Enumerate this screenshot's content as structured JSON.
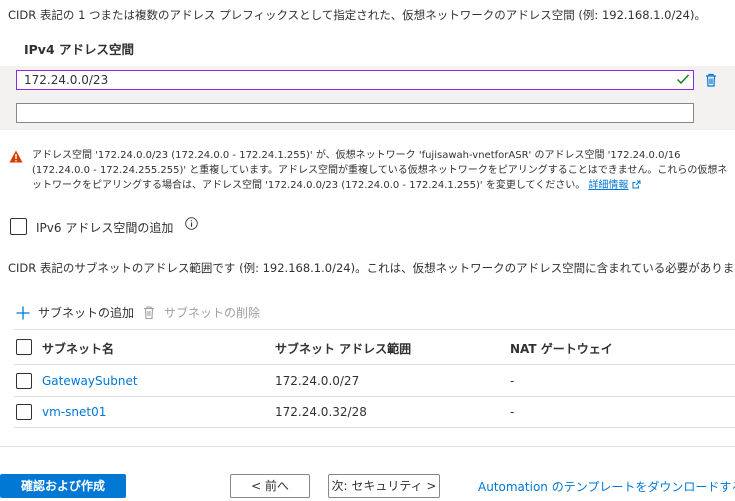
{
  "intro_text": "CIDR 表記の 1 つまたは複数のアドレス プレフィックスとして指定された、仮想ネットワークのアドレス空間 (例: 192.168.1.0/24)。",
  "ipv4": {
    "label": "IPv4 アドレス空間",
    "value": "172.24.0.0/23",
    "empty_value": ""
  },
  "warning": {
    "text": "アドレス空間 '172.24.0.0/23 (172.24.0.0 - 172.24.1.255)' が、仮想ネットワーク 'fujisawah-vnetforASR' のアドレス空間 '172.24.0.0/16 (172.24.0.0 - 172.24.255.255)' と重複しています。アドレス空間が重複している仮想ネットワークをピアリングすることはできません。これらの仮想ネットワークをピアリングする場合は、アドレス空間 '172.24.0.0/23 (172.24.0.0 - 172.24.1.255)' を変更してください。",
    "link": "詳細情報"
  },
  "ipv6": {
    "label": "IPv6 アドレス空間の追加"
  },
  "cidr_description": "CIDR 表記のサブネットのアドレス範囲です (例: 192.168.1.0/24)。これは、仮想ネットワークのアドレス空間に含まれている必要があります。",
  "toolbar": {
    "add_subnet": "サブネットの追加",
    "delete_subnet": "サブネットの削除"
  },
  "table": {
    "headers": [
      "サブネット名",
      "サブネット アドレス範囲",
      "NAT ゲートウェイ"
    ],
    "rows": [
      {
        "name": "GatewaySubnet",
        "range": "172.24.0.0/27",
        "nat": "-"
      },
      {
        "name": "vm-snet01",
        "range": "172.24.0.32/28",
        "nat": "-"
      }
    ]
  },
  "footer": {
    "review_create": "確認および作成",
    "prev": "< 前へ",
    "next": "次: セキュリティ >",
    "download_template": "Automation のテンプレートをダウンロードする"
  },
  "colors": {
    "accent": "#0078d4",
    "warning": "#d83b01",
    "check": "#107c10",
    "focus_border": "#8a2be2"
  }
}
